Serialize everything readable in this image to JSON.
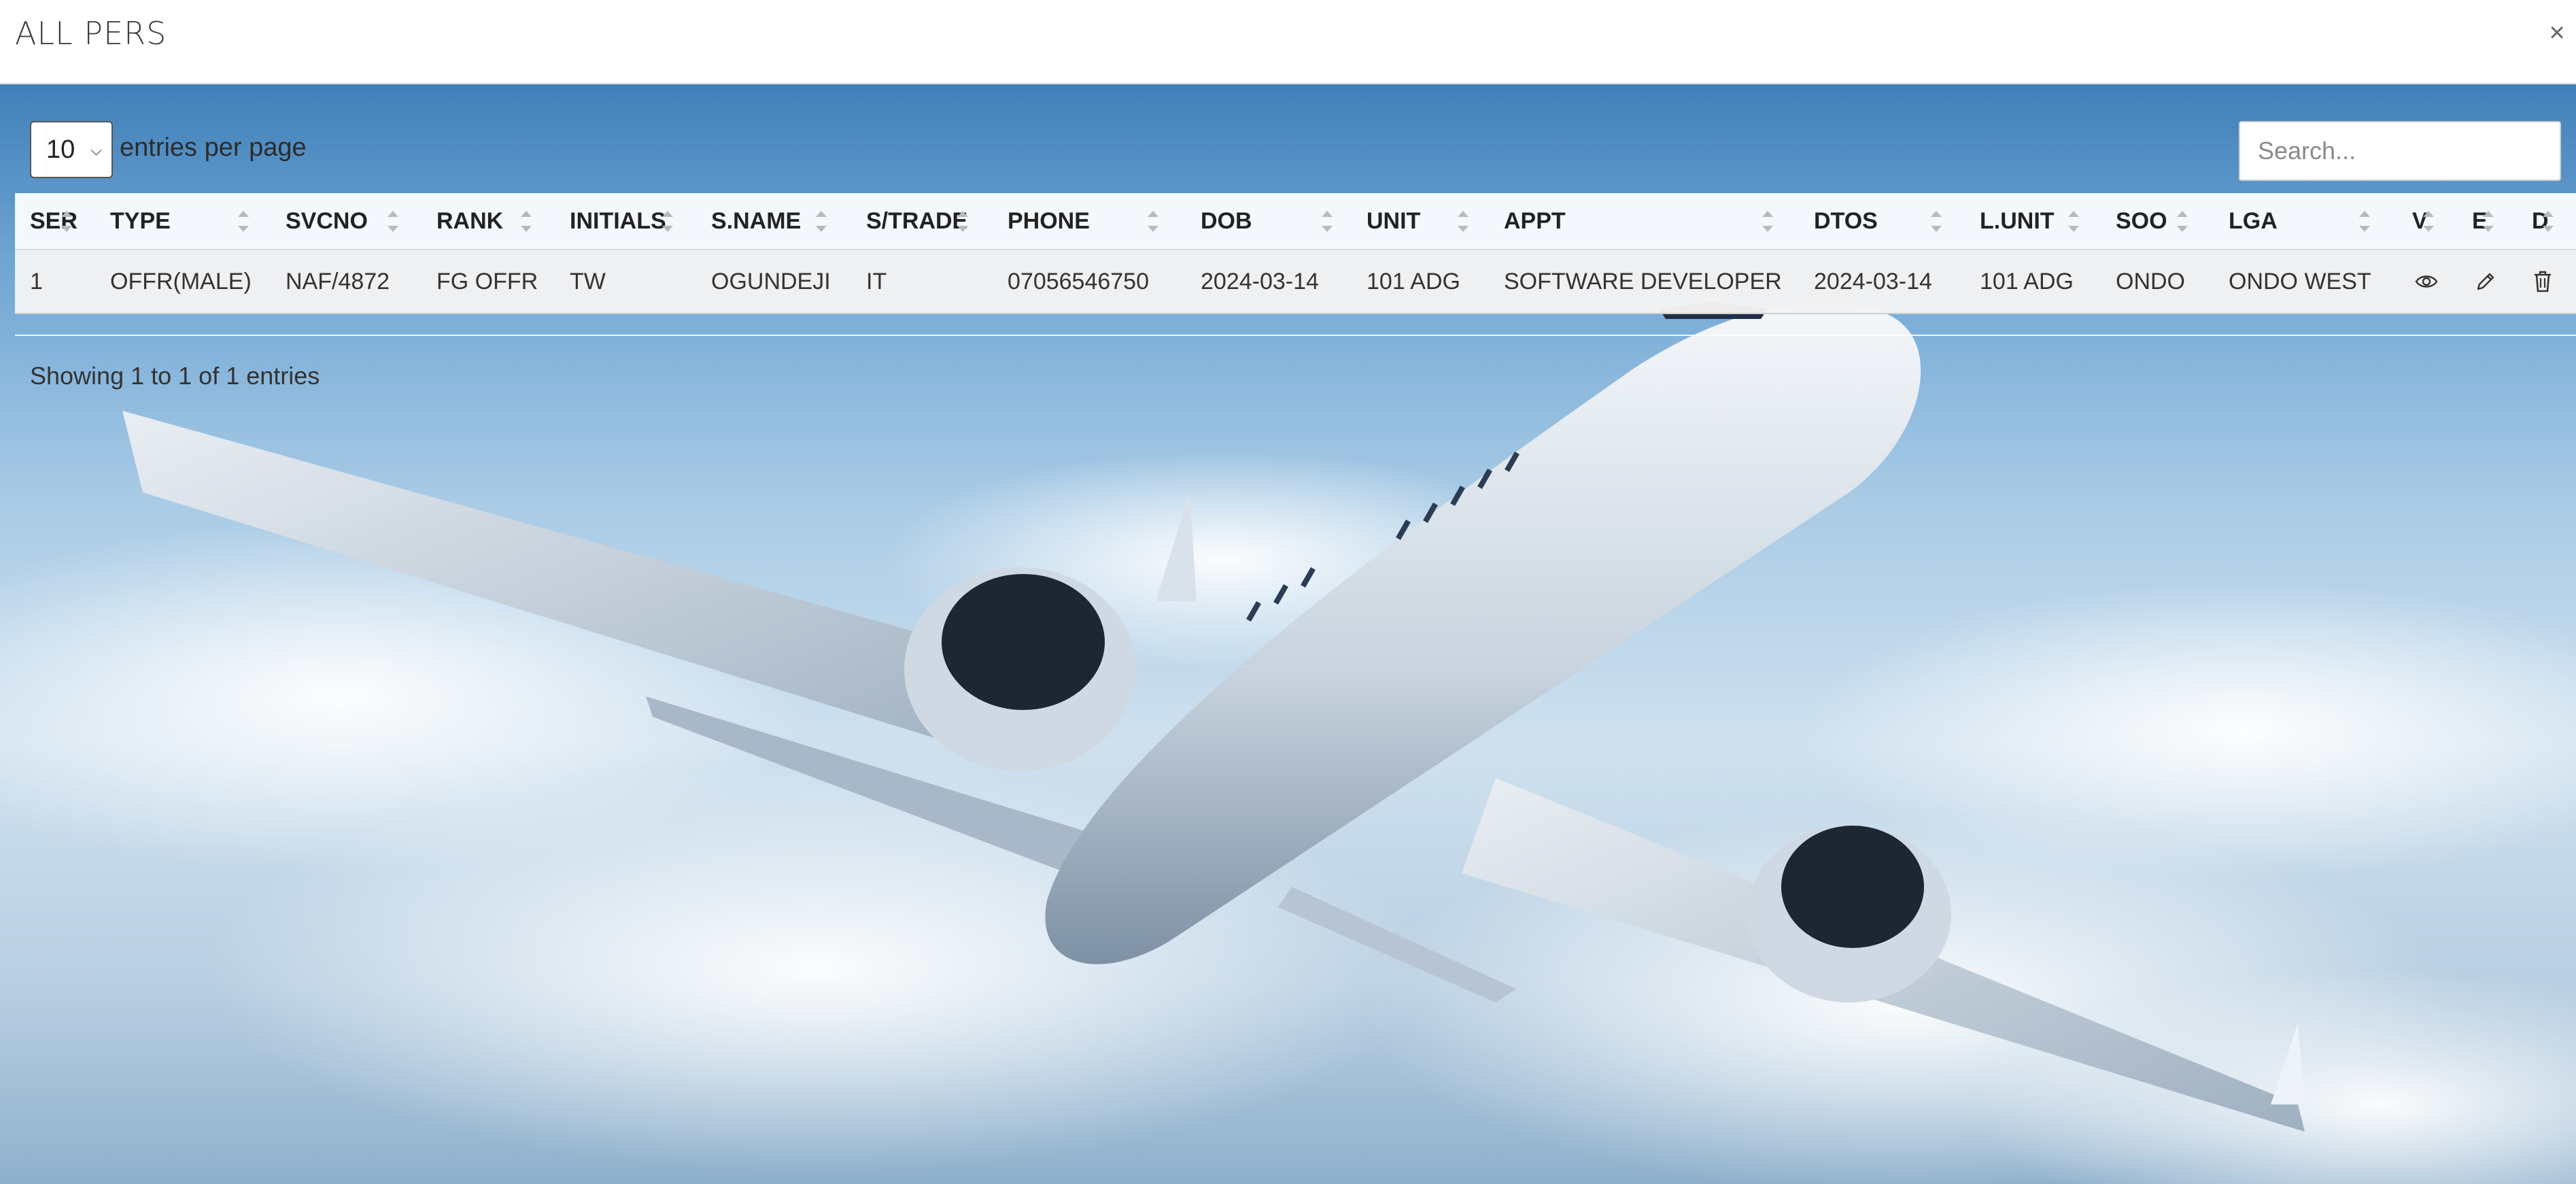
{
  "dialog": {
    "title": "ALL PERS",
    "close_label": "×"
  },
  "controls": {
    "entries_value": "10",
    "entries_label": "entries per page",
    "search_placeholder": "Search..."
  },
  "table": {
    "columns": [
      "SER",
      "TYPE",
      "SVCNO",
      "RANK",
      "INITIALS",
      "S.NAME",
      "S/TRADE",
      "PHONE",
      "DOB",
      "UNIT",
      "APPT",
      "DTOS",
      "L.UNIT",
      "SOO",
      "LGA",
      "V",
      "E",
      "D"
    ],
    "rows": [
      {
        "ser": "1",
        "type": "OFFR(MALE)",
        "svcno": "NAF/4872",
        "rank": "FG OFFR",
        "initials": "TW",
        "sname": "OGUNDEJI",
        "strade": "IT",
        "phone": "07056546750",
        "dob": "2024-03-14",
        "unit": "101 ADG",
        "appt": "SOFTWARE DEVELOPER",
        "dtos": "2024-03-14",
        "lunit": "101 ADG",
        "soo": "ONDO",
        "lga": "ONDO WEST"
      }
    ],
    "actions": {
      "view_icon": "eye-icon",
      "edit_icon": "pencil-icon",
      "delete_icon": "trash-icon"
    }
  },
  "footer": {
    "info": "Showing 1 to 1 of 1 entries"
  },
  "theme": {
    "background": "sky-with-airplane",
    "header_bg": "#ffffff"
  }
}
